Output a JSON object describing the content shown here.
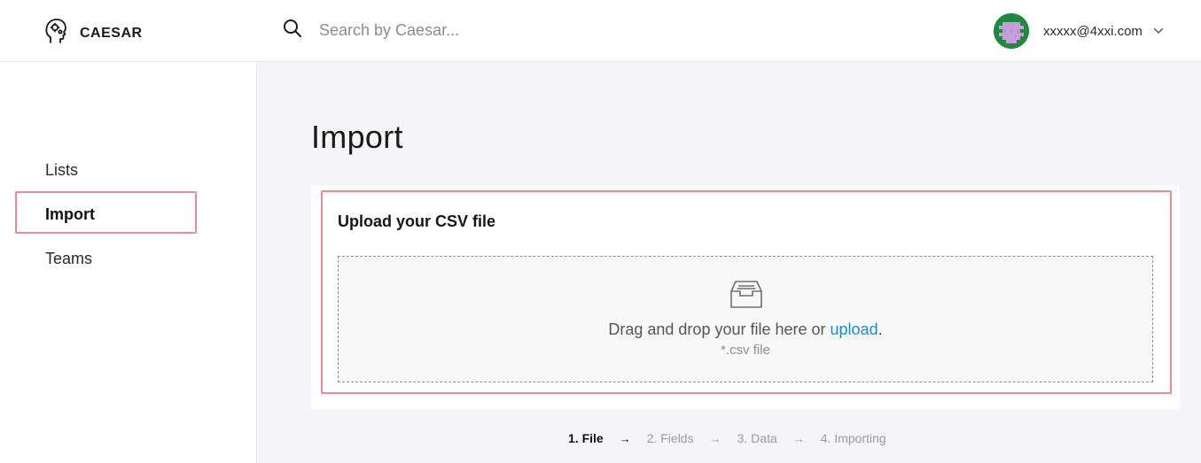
{
  "brand": {
    "name": "CAESAR",
    "icon": "head-gears-icon"
  },
  "search": {
    "placeholder": "Search by Caesar...",
    "icon": "search-icon"
  },
  "user": {
    "email": "xxxxx@4xxi.com",
    "avatar_color": "#1e8a3e",
    "avatar_accent": "#c99be0"
  },
  "sidebar": {
    "items": [
      {
        "label": "Lists",
        "active": false
      },
      {
        "label": "Import",
        "active": true
      },
      {
        "label": "Teams",
        "active": false
      }
    ]
  },
  "main": {
    "title": "Import",
    "upload": {
      "title": "Upload your CSV file",
      "drop_text": "Drag and drop your file here or",
      "link_text": "upload",
      "period": ".",
      "hint": "*.csv file",
      "icon": "inbox-tray-icon"
    },
    "steps": [
      {
        "label": "1. File",
        "current": true
      },
      {
        "label": "2. Fields",
        "current": false
      },
      {
        "label": "3. Data",
        "current": false
      },
      {
        "label": "4. Importing",
        "current": false
      }
    ],
    "arrow": "→"
  },
  "colors": {
    "highlight": "#ef8a92",
    "link": "#1e88d2",
    "background": "#f5f5f7"
  }
}
